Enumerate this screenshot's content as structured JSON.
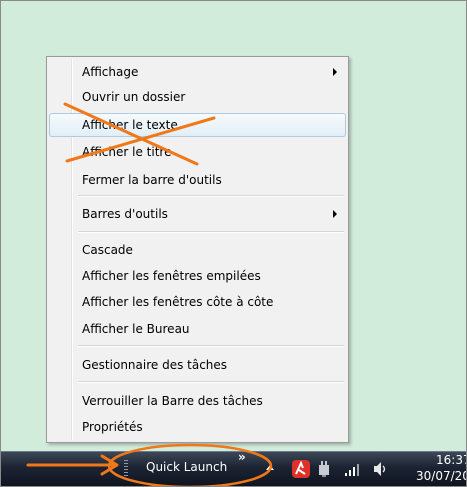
{
  "menu": {
    "items": [
      {
        "label": "Affichage",
        "submenu": true
      },
      {
        "label": "Ouvrir un dossier",
        "submenu": false
      },
      {
        "label": "Afficher le texte",
        "submenu": false,
        "highlighted": true
      },
      {
        "label": "Afficher le titre",
        "submenu": false
      },
      {
        "label": "Fermer la barre d'outils",
        "submenu": false
      },
      {
        "label": "Barres d'outils",
        "submenu": true
      },
      {
        "label": "Cascade",
        "submenu": false
      },
      {
        "label": "Afficher les fenêtres empilées",
        "submenu": false
      },
      {
        "label": "Afficher les fenêtres côte à côte",
        "submenu": false
      },
      {
        "label": "Afficher le Bureau",
        "submenu": false
      },
      {
        "label": "Gestionnaire des tâches",
        "submenu": false
      },
      {
        "label": "Verrouiller la Barre des tâches",
        "submenu": false
      },
      {
        "label": "Propriétés",
        "submenu": false
      }
    ]
  },
  "taskbar": {
    "toolbar_label": "Quick Launch",
    "chevron": "»",
    "tray_icons": [
      "antivirus-icon",
      "network-plug-icon",
      "signal-strength-icon",
      "speaker-icon"
    ],
    "clock_time": "16:37",
    "clock_date": "30/07/20"
  },
  "annotations": {
    "strike_color": "#f07818",
    "arrow_color": "#f07818",
    "ellipse_color": "#f07818"
  }
}
